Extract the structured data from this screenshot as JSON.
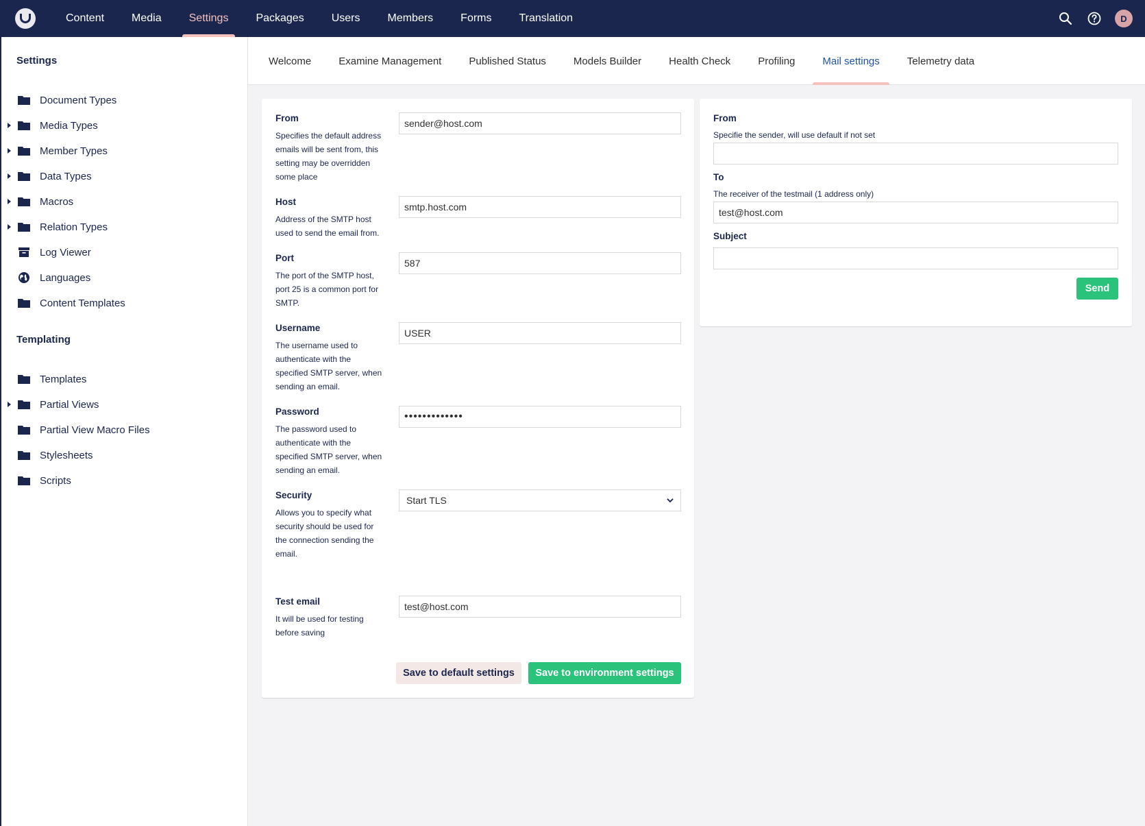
{
  "topnav": {
    "items": [
      {
        "label": "Content",
        "active": false
      },
      {
        "label": "Media",
        "active": false
      },
      {
        "label": "Settings",
        "active": true
      },
      {
        "label": "Packages",
        "active": false
      },
      {
        "label": "Users",
        "active": false
      },
      {
        "label": "Members",
        "active": false
      },
      {
        "label": "Forms",
        "active": false
      },
      {
        "label": "Translation",
        "active": false
      }
    ],
    "avatar_initial": "D"
  },
  "tree": {
    "settings_heading": "Settings",
    "settings_items": [
      {
        "label": "Document Types",
        "icon": "folder-icon",
        "expandable": false
      },
      {
        "label": "Media Types",
        "icon": "folder-icon",
        "expandable": true
      },
      {
        "label": "Member Types",
        "icon": "folder-icon",
        "expandable": true
      },
      {
        "label": "Data Types",
        "icon": "folder-icon",
        "expandable": true
      },
      {
        "label": "Macros",
        "icon": "folder-icon",
        "expandable": true
      },
      {
        "label": "Relation Types",
        "icon": "folder-icon",
        "expandable": true
      },
      {
        "label": "Log Viewer",
        "icon": "archive-icon",
        "expandable": false
      },
      {
        "label": "Languages",
        "icon": "globe-icon",
        "expandable": false
      },
      {
        "label": "Content Templates",
        "icon": "folder-icon",
        "expandable": false
      }
    ],
    "templating_heading": "Templating",
    "templating_items": [
      {
        "label": "Templates",
        "icon": "folder-icon",
        "expandable": false
      },
      {
        "label": "Partial Views",
        "icon": "folder-icon",
        "expandable": true
      },
      {
        "label": "Partial View Macro Files",
        "icon": "folder-icon",
        "expandable": false
      },
      {
        "label": "Stylesheets",
        "icon": "folder-icon",
        "expandable": false
      },
      {
        "label": "Scripts",
        "icon": "folder-icon",
        "expandable": false
      }
    ]
  },
  "tabs": [
    {
      "label": "Welcome",
      "active": false
    },
    {
      "label": "Examine Management",
      "active": false
    },
    {
      "label": "Published Status",
      "active": false
    },
    {
      "label": "Models Builder",
      "active": false
    },
    {
      "label": "Health Check",
      "active": false
    },
    {
      "label": "Profiling",
      "active": false
    },
    {
      "label": "Mail settings",
      "active": true
    },
    {
      "label": "Telemetry data",
      "active": false
    }
  ],
  "mail_form": {
    "from": {
      "label": "From",
      "description": "Specifies the default address emails will be sent from, this setting may be overridden some place",
      "value": "sender@host.com"
    },
    "host": {
      "label": "Host",
      "description": "Address of the SMTP host used to send the email from.",
      "value": "smtp.host.com"
    },
    "port": {
      "label": "Port",
      "description": "The port of the SMTP host, port 25 is a common port for SMTP.",
      "value": "587"
    },
    "username": {
      "label": "Username",
      "description": "The username used to authenticate with the specified SMTP server, when sending an email.",
      "value": "USER"
    },
    "password": {
      "label": "Password",
      "description": "The password used to authenticate with the specified SMTP server, when sending an email.",
      "value": "•••••••••••••"
    },
    "security": {
      "label": "Security",
      "description": "Allows you to specify what security should be used for the connection sending the email.",
      "value": "Start TLS"
    },
    "test_email": {
      "label": "Test email",
      "description": "It will be used for testing before saving",
      "value": "test@host.com"
    },
    "save_default_label": "Save to default settings",
    "save_env_label": "Save to environment settings"
  },
  "test_mail": {
    "from": {
      "label": "From",
      "description": "Specifie the sender, will use default if not set",
      "value": ""
    },
    "to": {
      "label": "To",
      "description": "The receiver of the testmail (1 address only)",
      "value": "test@host.com"
    },
    "subject": {
      "label": "Subject",
      "value": ""
    },
    "send_label": "Send"
  },
  "colors": {
    "header_bg": "#1b264f",
    "accent_pink": "#f5c1bc",
    "active_tab_text": "#2152a3",
    "success_green": "#2bc37c"
  }
}
